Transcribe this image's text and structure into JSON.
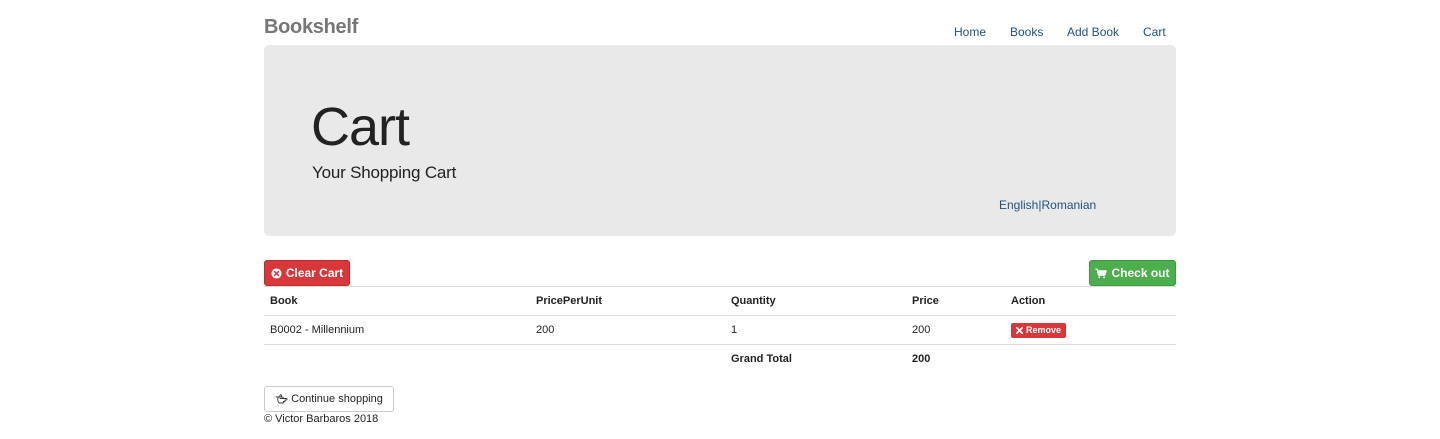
{
  "header": {
    "brand": "Bookshelf",
    "nav": [
      "Home",
      "Books",
      "Add Book",
      "Cart"
    ]
  },
  "jumbotron": {
    "title": "Cart",
    "subtitle": "Your Shopping Cart",
    "languages": [
      "English",
      "Romanian"
    ],
    "language_separator": "|"
  },
  "actions": {
    "clear_label": "Clear Cart",
    "clear_icon": "times-circle-icon",
    "checkout_label": "Check out",
    "checkout_icon": "shopping-cart-icon"
  },
  "table": {
    "headers": [
      "Book",
      "PricePerUnit",
      "Quantity",
      "Price",
      "Action"
    ],
    "rows": [
      {
        "book": "B0002 - Millennium",
        "price_per_unit": "200",
        "quantity": "1",
        "price": "200",
        "action_label": "Remove",
        "action_icon": "times-icon"
      }
    ],
    "grand_total_label": "Grand Total",
    "grand_total_value": "200"
  },
  "continue": {
    "label": "Continue shopping",
    "icon": "hand-pointing-left-icon"
  },
  "footer": {
    "text": "© Victor Barbaros 2018"
  },
  "colors": {
    "danger": "#d9383a",
    "success": "#4cae4c",
    "link": "#23527c",
    "jumbotron_bg": "#e9e9e9"
  }
}
